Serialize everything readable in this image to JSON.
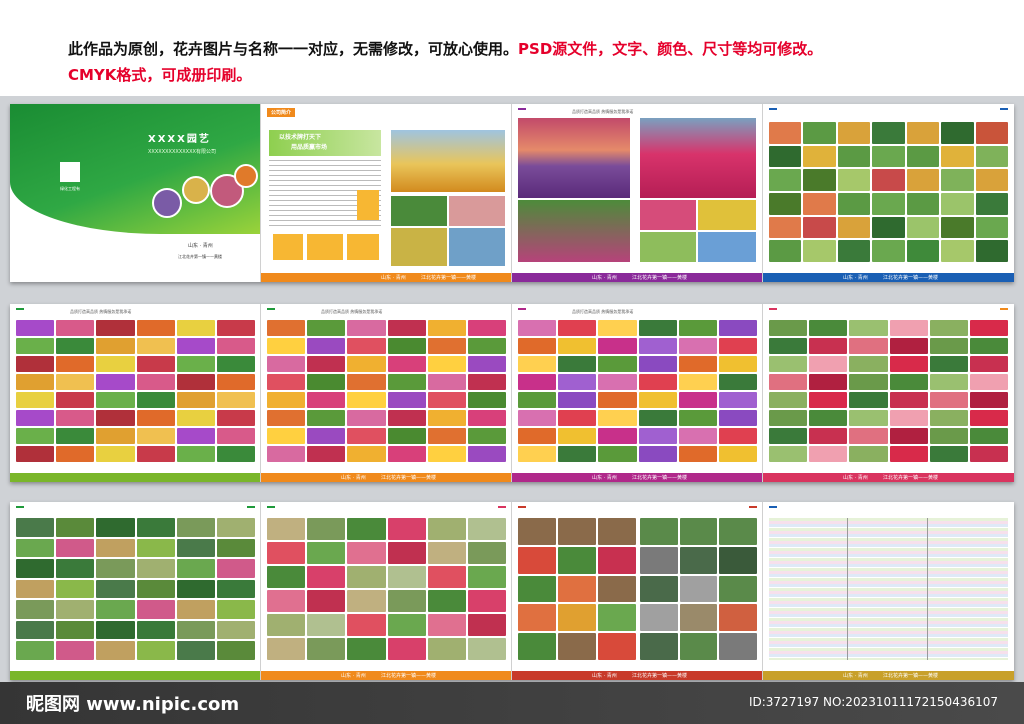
{
  "notice": {
    "line1_black": "此作品为原创，花卉图片与名称一一对应，无需修改，可放心使用。",
    "line1_red": "PSD源文件，文字、颜色、尺寸等均可修改。",
    "line2_red": "CMYK格式，可成册印刷。"
  },
  "cover": {
    "title": "XXXX园艺",
    "subtitle": "XXXXXXXXXXXXXX有限公司",
    "logo_text": "绿化工程有",
    "location": "山东 · 青州",
    "tagline": "江北花卉第一镇——黄楼"
  },
  "intro_page": {
    "label": "公司简介",
    "banner_line1": "以技术牌打天下",
    "banner_line2": "用品质赢市场"
  },
  "slogan": "品质打造高品质 热情服务是我承诺",
  "footer_location": "山东 · 青州",
  "footer_tagline": "江北花卉第一镇——黄楼",
  "watermark": {
    "brand": "昵图网 www.nipic.com",
    "id": "ID:3727197 NO:20231011172150436107"
  },
  "colors": {
    "green": "#1f9a3a",
    "red": "#e5002b",
    "orange": "#f08a1c",
    "blue": "#1a5fb4",
    "purple": "#8a2a9a",
    "pink": "#d9345f"
  }
}
